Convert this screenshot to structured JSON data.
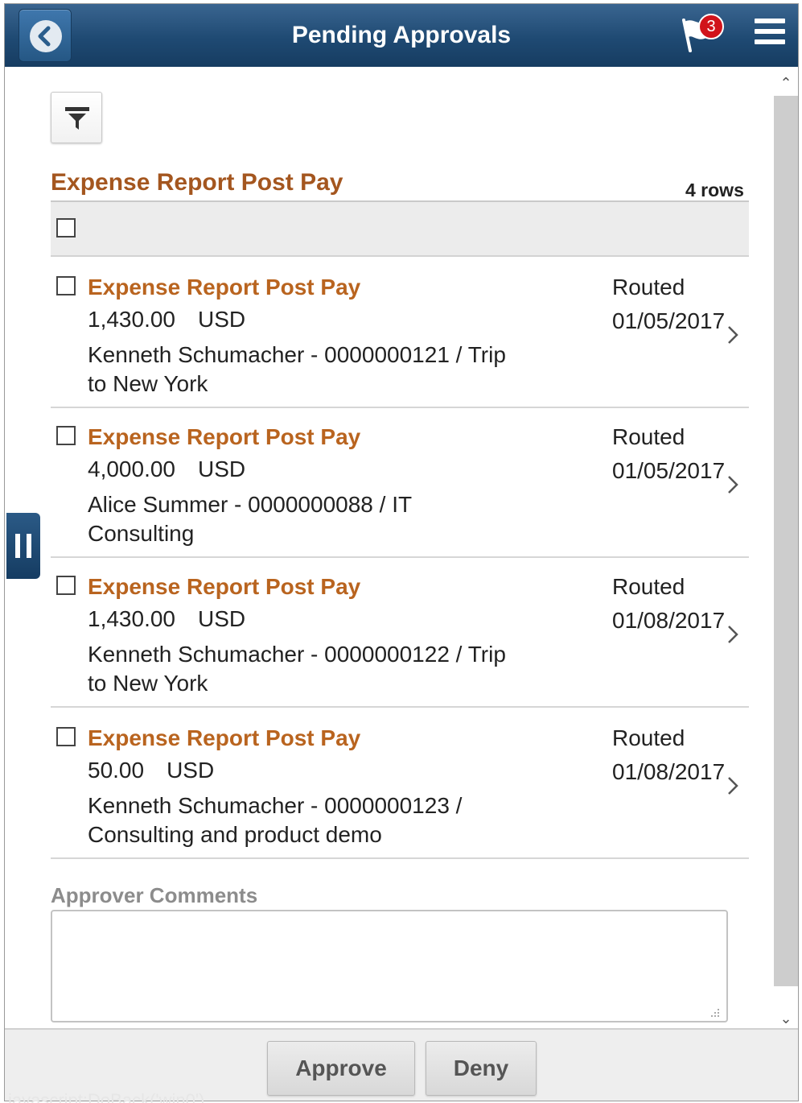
{
  "header": {
    "title": "Pending Approvals",
    "notification_count": "3",
    "back_icon": "chevron-left-icon",
    "flag_icon": "flag-icon",
    "menu_icon": "hamburger-menu-icon",
    "bar_color": "#1f4a73"
  },
  "toolbar": {
    "filter_icon": "filter-icon"
  },
  "section": {
    "title": "Expense Report Post Pay",
    "row_count": "4 rows"
  },
  "items": [
    {
      "title": "Expense Report Post Pay",
      "amount": "1,430.00",
      "currency": "USD",
      "description": "Kenneth Schumacher - 0000000121 / Trip to New York",
      "status": "Routed",
      "date": "01/05/2017"
    },
    {
      "title": "Expense Report Post Pay",
      "amount": "4,000.00",
      "currency": "USD",
      "description": "Alice Summer - 0000000088 / IT Consulting",
      "status": "Routed",
      "date": "01/05/2017"
    },
    {
      "title": "Expense Report Post Pay",
      "amount": "1,430.00",
      "currency": "USD",
      "description": "Kenneth Schumacher - 0000000122 / Trip to New York",
      "status": "Routed",
      "date": "01/08/2017"
    },
    {
      "title": "Expense Report Post Pay",
      "amount": "50.00",
      "currency": "USD",
      "description": "Kenneth Schumacher - 0000000123 / Consulting and product demo",
      "status": "Routed",
      "date": "01/08/2017"
    }
  ],
  "comments": {
    "label": "Approver Comments",
    "value": ""
  },
  "footer": {
    "approve_label": "Approve",
    "deny_label": "Deny"
  },
  "status_bar": {
    "text": "javascript:DoBack('win0')"
  },
  "colors": {
    "title_accent": "#b9641f",
    "header_bg": "#1f4a73",
    "badge": "#d1131b"
  }
}
